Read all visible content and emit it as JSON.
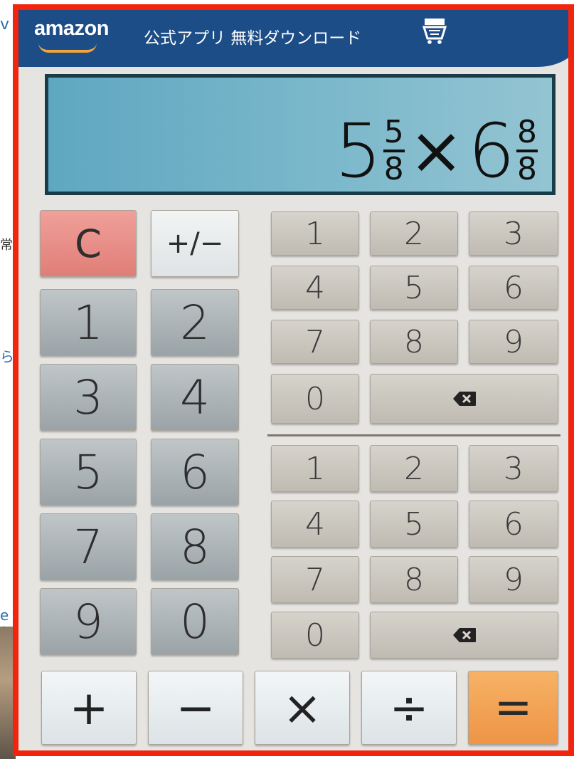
{
  "background_fragments": [
    "v",
    "常",
    "ら",
    "e ("
  ],
  "header": {
    "brand": "amazon",
    "promo": "公式アプリ 無料ダウンロード",
    "cart_icon": "cart-icon",
    "color": "#1d4d86"
  },
  "display": {
    "whole_a": "5",
    "num_a": "5",
    "den_a": "8",
    "operator": "×",
    "whole_b": "6",
    "num_b": "8",
    "den_b": "8"
  },
  "left_keys": {
    "clear": "C",
    "sign": "+/−",
    "digits": [
      "1",
      "2",
      "3",
      "4",
      "5",
      "6",
      "7",
      "8",
      "9",
      "0"
    ]
  },
  "numerator_pad": {
    "digits": [
      "1",
      "2",
      "3",
      "4",
      "5",
      "6",
      "7",
      "8",
      "9",
      "0"
    ],
    "backspace_icon": "backspace-icon"
  },
  "denominator_pad": {
    "digits": [
      "1",
      "2",
      "3",
      "4",
      "5",
      "6",
      "7",
      "8",
      "9",
      "0"
    ],
    "backspace_icon": "backspace-icon"
  },
  "operators": {
    "add": "+",
    "subtract": "−",
    "multiply": "×",
    "divide": "÷",
    "equals": "="
  },
  "colors": {
    "frame": "#f2240e",
    "clear": "#e8877f",
    "equals": "#f0994a"
  }
}
